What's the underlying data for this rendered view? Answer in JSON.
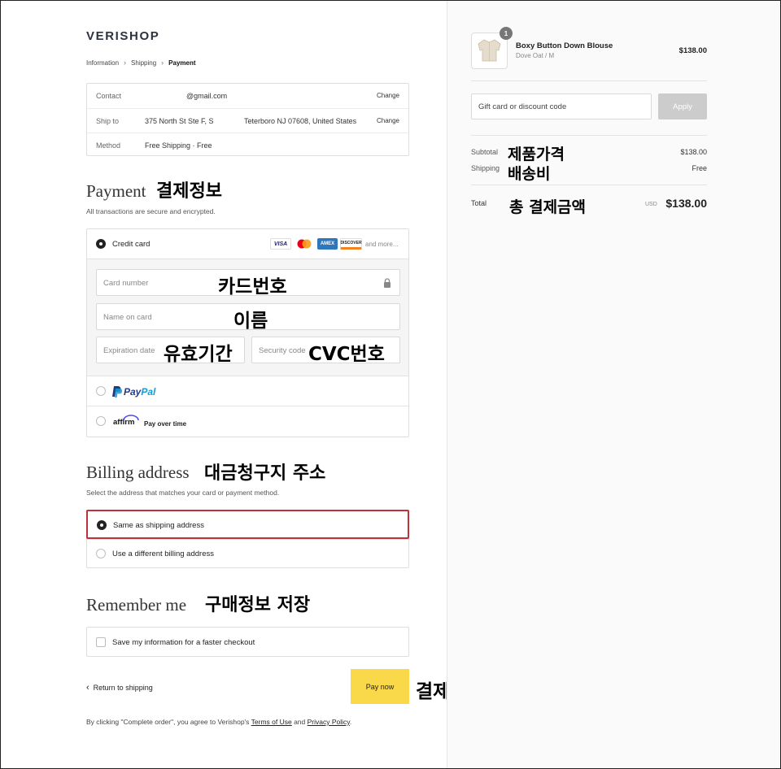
{
  "brand": {
    "logo": "VERISHOP"
  },
  "breadcrumb": {
    "items": [
      "Information",
      "Shipping",
      "Payment"
    ]
  },
  "info": {
    "contact_label": "Contact",
    "contact_value": "@gmail.com",
    "shipto_label": "Ship to",
    "shipto_street": "375 North St Ste F, S",
    "shipto_city": "Teterboro NJ 07608, United States",
    "method_label": "Method",
    "method_value": "Free Shipping · Free",
    "change_label": "Change"
  },
  "payment": {
    "title": "Payment",
    "annotation": "결제정보",
    "subtitle": "All transactions are secure and encrypted.",
    "credit_card_label": "Credit card",
    "card_brands": [
      "VISA",
      "MC",
      "AMEX",
      "DISCOVER"
    ],
    "and_more": "and more...",
    "card_number_placeholder": "Card number",
    "card_number_annotation": "카드번호",
    "name_placeholder": "Name on card",
    "name_annotation": "이름",
    "expiry_placeholder": "Expiration date",
    "expiry_annotation": "유효기간",
    "cvc_placeholder": "Security code",
    "cvc_annotation": "CVC번호",
    "paypal_logo_p": "Pay",
    "paypal_logo_pal": "Pal",
    "affirm_logo": "affirm",
    "affirm_label": "Pay over time"
  },
  "billing": {
    "title": "Billing address",
    "annotation": "대금청구지 주소",
    "subtitle": "Select the address that matches your card or payment method.",
    "same_label": "Same as shipping address",
    "different_label": "Use a different billing address"
  },
  "remember": {
    "title": "Remember me",
    "annotation": "구매정보 저장",
    "checkbox_label": "Save my information for a faster checkout"
  },
  "actions": {
    "return_label": "Return to shipping",
    "pay_label": "Pay now",
    "pay_annotation": "결제",
    "legal_prefix": "By clicking \"Complete order\", you agree to Verishop's ",
    "terms_label": "Terms of Use",
    "legal_and": " and ",
    "privacy_label": "Privacy Policy",
    "legal_suffix": "."
  },
  "summary": {
    "quantity": "1",
    "product_name": "Boxy Button Down Blouse",
    "product_variant": "Dove Oat / M",
    "product_price": "$138.00",
    "gift_placeholder": "Gift card or discount code",
    "apply_label": "Apply",
    "subtotal_label": "Subtotal",
    "subtotal_annotation": "제품가격",
    "subtotal_value": "$138.00",
    "shipping_label": "Shipping",
    "shipping_annotation": "배송비",
    "shipping_value": "Free",
    "total_label": "Total",
    "total_annotation": "총 결제금액",
    "currency": "USD",
    "total_value": "$138.00"
  },
  "colors": {
    "accent_yellow": "#f9d84a",
    "selected_border": "#c0323a",
    "paypal_dark": "#253b80",
    "paypal_light": "#179bd7"
  }
}
